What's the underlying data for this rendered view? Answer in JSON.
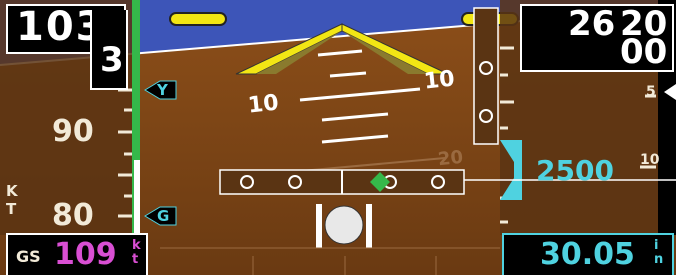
{
  "airspeed": {
    "current": "103",
    "drum_digit": "3",
    "tape_labels": [
      "90",
      "80"
    ],
    "unit_letters": [
      "K",
      "T"
    ],
    "y_bug": "Y",
    "g_bug": "G"
  },
  "groundspeed": {
    "label": "GS",
    "value": "109",
    "unit": [
      "k",
      "t"
    ]
  },
  "altimeter": {
    "current": "26",
    "current_sub": "20",
    "drum": "00",
    "selected_altitude": "2500",
    "tape_marks": [
      "5",
      "10"
    ]
  },
  "barometer": {
    "value": "30.05",
    "unit": [
      "i",
      "n"
    ]
  },
  "attitude": {
    "pitch_labels_left": [
      "10"
    ],
    "pitch_labels_right": [
      "10",
      "20"
    ]
  },
  "colors": {
    "sky": "#3d55b8",
    "ground": "#7a4414",
    "tape": "#5a3413",
    "cyan": "#4fd2e0",
    "magenta": "#d94fd3",
    "yellow": "#f2e614",
    "green": "#35b84a"
  }
}
